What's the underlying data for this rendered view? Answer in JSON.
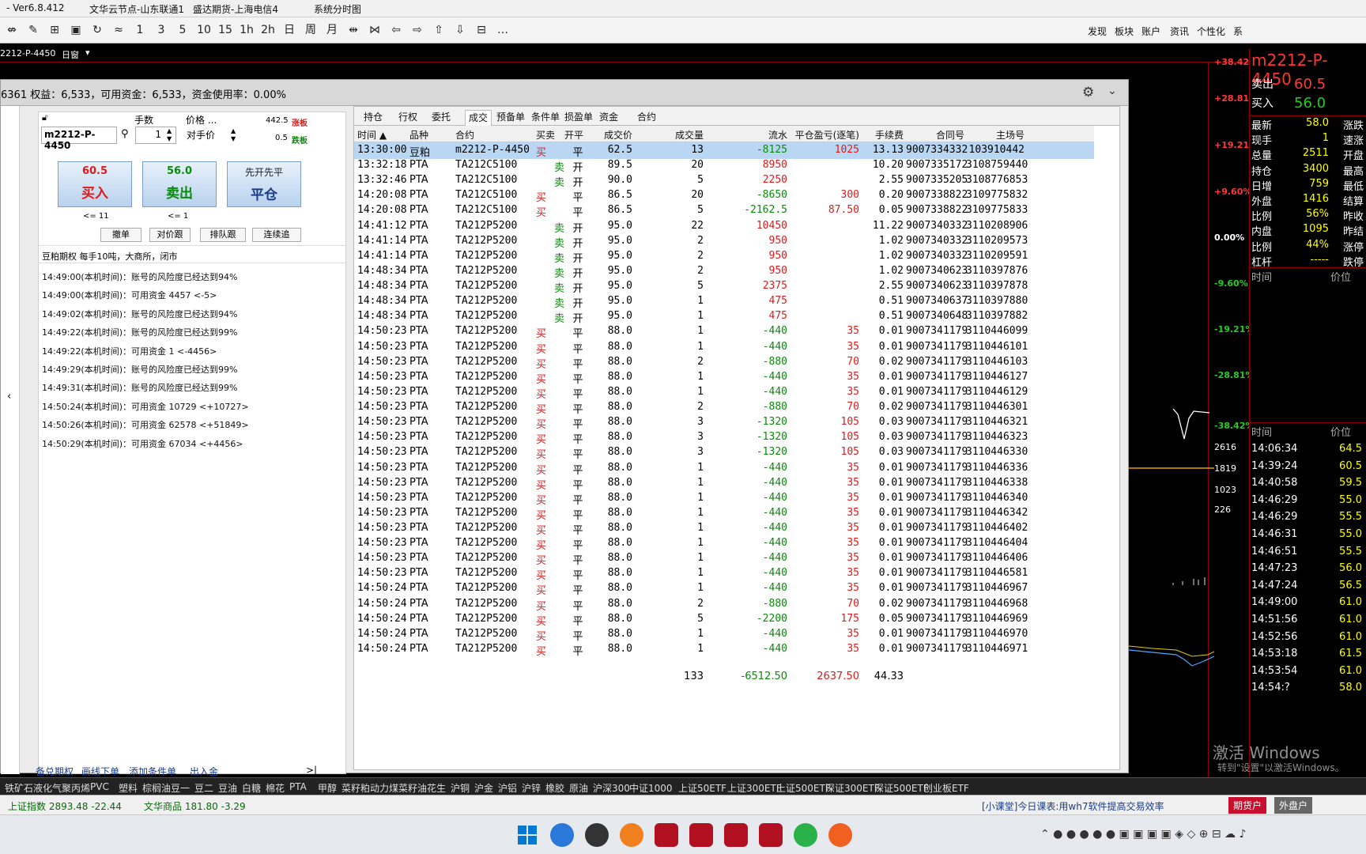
{
  "titlebar": {
    "version": "- Ver6.8.412",
    "node": "文华云节点-山东联通1",
    "broker": "盛达期货-上海电信4",
    "view": "系统分时图"
  },
  "toolbar": {
    "glyphs": [
      "⇎",
      "✎",
      "⊞",
      "▣",
      "↻",
      "≈",
      "1",
      "3",
      "5",
      "10",
      "15",
      "1h",
      "2h",
      "日",
      "周",
      "月",
      "⇹",
      "⋈",
      "⇦",
      "⇨",
      "⇧",
      "⇩",
      "⊟",
      "…"
    ],
    "menus": [
      "发现",
      "板块",
      "账户",
      "资讯",
      "个性化",
      "系"
    ]
  },
  "chartbar": {
    "symbol": "2212-P-4450",
    "period": "日窗"
  },
  "chart": {
    "pct_labels": [
      "+38.42%",
      "+28.81%",
      "+19.21%",
      "+9.60%",
      "0.00%",
      "-9.60%",
      "-19.21%",
      "-28.81%",
      "-38.42%"
    ],
    "vol_labels": [
      "2616",
      "1819",
      "1023",
      "226"
    ]
  },
  "quote": {
    "symbol": "m2212-P-4450",
    "ask_label": "卖出",
    "ask": "60.5",
    "bid_label": "买入",
    "bid": "56.0",
    "rows": [
      {
        "a": "最新",
        "b": "58.0",
        "c": "涨跌"
      },
      {
        "a": "现手",
        "b": "1",
        "c": "速涨"
      },
      {
        "a": "总量",
        "b": "2511",
        "c": "开盘"
      },
      {
        "a": "持仓",
        "b": "3400",
        "c": "最高"
      },
      {
        "a": "日增",
        "b": "759",
        "c": "最低"
      },
      {
        "a": "外盘",
        "b": "1416",
        "c": "结算"
      },
      {
        "a": "比例",
        "b": "56%",
        "c": "昨收"
      },
      {
        "a": "内盘",
        "b": "1095",
        "c": "昨结"
      },
      {
        "a": "比例",
        "b": "44%",
        "c": "涨停"
      },
      {
        "a": "杠杆",
        "b": "-----",
        "c": "跌停"
      }
    ],
    "head1": {
      "t": "时间",
      "p": "价位"
    },
    "head2": {
      "t": "时间",
      "p": "价位"
    },
    "ticks": [
      {
        "t": "14:06:34",
        "p": "64.5"
      },
      {
        "t": "14:39:24",
        "p": "60.5"
      },
      {
        "t": "14:40:58",
        "p": "59.5"
      },
      {
        "t": "14:46:29",
        "p": "55.0"
      },
      {
        "t": "14:46:29",
        "p": "55.5"
      },
      {
        "t": "14:46:31",
        "p": "55.0"
      },
      {
        "t": "14:46:51",
        "p": "55.5"
      },
      {
        "t": "14:47:23",
        "p": "56.0"
      },
      {
        "t": "14:47:24",
        "p": "56.5"
      },
      {
        "t": "14:49:00",
        "p": "61.0"
      },
      {
        "t": "14:51:56",
        "p": "61.0"
      },
      {
        "t": "14:52:56",
        "p": "61.0"
      },
      {
        "t": "14:53:18",
        "p": "61.5"
      },
      {
        "t": "14:53:54",
        "p": "61.0"
      },
      {
        "t": "14:54:?",
        "p": "58.0"
      }
    ]
  },
  "window": {
    "title": "6361 权益：6,533，可用资金：6,533，资金使用率：0.00%"
  },
  "order": {
    "contract": "m2212-P-4450",
    "qty_label": "手数",
    "qty": "1",
    "price_label": "价格 ...",
    "price_mode": "对手价",
    "limit_up": "442.5",
    "limit_up_label": "涨板",
    "limit_down": "0.5",
    "limit_down_label": "跌板",
    "buy": {
      "price": "60.5",
      "label": "买入",
      "limit": "<= 11"
    },
    "sell": {
      "price": "56.0",
      "label": "卖出",
      "limit": "<= 1"
    },
    "close": {
      "price": "先开先平",
      "label": "平仓"
    },
    "small_buttons": [
      "撤单",
      "对价跟",
      "排队跟",
      "连续追"
    ],
    "info": "豆粕期权  每手10吨，大商所，闭市"
  },
  "logs": [
    "14:49:00(本机时间)：账号的风险度已经达到94%",
    "14:49:00(本机时间)：可用资金 4457 <-5>",
    "14:49:02(本机时间)：账号的风险度已经达到94%",
    "14:49:22(本机时间)：账号的风险度已经达到99%",
    "14:49:22(本机时间)：可用资金 1 <-4456>",
    "14:49:29(本机时间)：账号的风险度已经达到99%",
    "14:49:31(本机时间)：账号的风险度已经达到99%",
    "14:50:24(本机时间)：可用资金 10729 <+10727>",
    "14:50:26(本机时间)：可用资金 62578 <+51849>",
    "14:50:29(本机时间)：可用资金 67034 <+4456>"
  ],
  "bottom_links": [
    "备兑期权",
    "画线下单",
    "添加条件单",
    "出入金"
  ],
  "tabs": [
    "持仓",
    "行权",
    "委托",
    "成交",
    "预备单",
    "条件单",
    "损盈单",
    "资金",
    "合约"
  ],
  "columns": [
    "时间 ▲",
    "品种",
    "合约",
    "买卖",
    "开平",
    "成交价",
    "成交量",
    "流水",
    "平仓盈亏(逐笔)",
    "手续费",
    "合同号",
    "主场号"
  ],
  "trades": [
    [
      "13:30:00",
      "豆粕",
      "m2212-P-4450",
      "买",
      "平",
      "62.5",
      "13",
      "-8125",
      "1025",
      "13.13",
      "9007334332",
      "103910442"
    ],
    [
      "13:32:18",
      "PTA",
      "TA212C5100",
      "卖",
      "开",
      "89.5",
      "20",
      "8950",
      "",
      "10.20",
      "9007335172",
      "3108759440"
    ],
    [
      "13:32:46",
      "PTA",
      "TA212C5100",
      "卖",
      "开",
      "90.0",
      "5",
      "2250",
      "",
      "2.55",
      "9007335205",
      "3108776853"
    ],
    [
      "14:20:08",
      "PTA",
      "TA212C5100",
      "买",
      "平",
      "86.5",
      "20",
      "-8650",
      "300",
      "0.20",
      "9007338822",
      "3109775832"
    ],
    [
      "14:20:08",
      "PTA",
      "TA212C5100",
      "买",
      "平",
      "86.5",
      "5",
      "-2162.5",
      "87.50",
      "0.05",
      "9007338822",
      "3109775833"
    ],
    [
      "14:41:12",
      "PTA",
      "TA212P5200",
      "卖",
      "开",
      "95.0",
      "22",
      "10450",
      "",
      "11.22",
      "9007340332",
      "3110208906"
    ],
    [
      "14:41:14",
      "PTA",
      "TA212P5200",
      "卖",
      "开",
      "95.0",
      "2",
      "950",
      "",
      "1.02",
      "9007340332",
      "3110209573"
    ],
    [
      "14:41:14",
      "PTA",
      "TA212P5200",
      "卖",
      "开",
      "95.0",
      "2",
      "950",
      "",
      "1.02",
      "9007340332",
      "3110209591"
    ],
    [
      "14:48:34",
      "PTA",
      "TA212P5200",
      "卖",
      "开",
      "95.0",
      "2",
      "950",
      "",
      "1.02",
      "9007340623",
      "3110397876"
    ],
    [
      "14:48:34",
      "PTA",
      "TA212P5200",
      "卖",
      "开",
      "95.0",
      "5",
      "2375",
      "",
      "2.55",
      "9007340623",
      "3110397878"
    ],
    [
      "14:48:34",
      "PTA",
      "TA212P5200",
      "卖",
      "开",
      "95.0",
      "1",
      "475",
      "",
      "0.51",
      "9007340637",
      "3110397880"
    ],
    [
      "14:48:34",
      "PTA",
      "TA212P5200",
      "卖",
      "开",
      "95.0",
      "1",
      "475",
      "",
      "0.51",
      "9007340648",
      "3110397882"
    ],
    [
      "14:50:23",
      "PTA",
      "TA212P5200",
      "买",
      "平",
      "88.0",
      "1",
      "-440",
      "35",
      "0.01",
      "9007341179",
      "3110446099"
    ],
    [
      "14:50:23",
      "PTA",
      "TA212P5200",
      "买",
      "平",
      "88.0",
      "1",
      "-440",
      "35",
      "0.01",
      "9007341179",
      "3110446101"
    ],
    [
      "14:50:23",
      "PTA",
      "TA212P5200",
      "买",
      "平",
      "88.0",
      "2",
      "-880",
      "70",
      "0.02",
      "9007341179",
      "3110446103"
    ],
    [
      "14:50:23",
      "PTA",
      "TA212P5200",
      "买",
      "平",
      "88.0",
      "1",
      "-440",
      "35",
      "0.01",
      "9007341179",
      "3110446127"
    ],
    [
      "14:50:23",
      "PTA",
      "TA212P5200",
      "买",
      "平",
      "88.0",
      "1",
      "-440",
      "35",
      "0.01",
      "9007341179",
      "3110446129"
    ],
    [
      "14:50:23",
      "PTA",
      "TA212P5200",
      "买",
      "平",
      "88.0",
      "2",
      "-880",
      "70",
      "0.02",
      "9007341179",
      "3110446301"
    ],
    [
      "14:50:23",
      "PTA",
      "TA212P5200",
      "买",
      "平",
      "88.0",
      "3",
      "-1320",
      "105",
      "0.03",
      "9007341179",
      "3110446321"
    ],
    [
      "14:50:23",
      "PTA",
      "TA212P5200",
      "买",
      "平",
      "88.0",
      "3",
      "-1320",
      "105",
      "0.03",
      "9007341179",
      "3110446323"
    ],
    [
      "14:50:23",
      "PTA",
      "TA212P5200",
      "买",
      "平",
      "88.0",
      "3",
      "-1320",
      "105",
      "0.03",
      "9007341179",
      "3110446330"
    ],
    [
      "14:50:23",
      "PTA",
      "TA212P5200",
      "买",
      "平",
      "88.0",
      "1",
      "-440",
      "35",
      "0.01",
      "9007341179",
      "3110446336"
    ],
    [
      "14:50:23",
      "PTA",
      "TA212P5200",
      "买",
      "平",
      "88.0",
      "1",
      "-440",
      "35",
      "0.01",
      "9007341179",
      "3110446338"
    ],
    [
      "14:50:23",
      "PTA",
      "TA212P5200",
      "买",
      "平",
      "88.0",
      "1",
      "-440",
      "35",
      "0.01",
      "9007341179",
      "3110446340"
    ],
    [
      "14:50:23",
      "PTA",
      "TA212P5200",
      "买",
      "平",
      "88.0",
      "1",
      "-440",
      "35",
      "0.01",
      "9007341179",
      "3110446342"
    ],
    [
      "14:50:23",
      "PTA",
      "TA212P5200",
      "买",
      "平",
      "88.0",
      "1",
      "-440",
      "35",
      "0.01",
      "9007341179",
      "3110446402"
    ],
    [
      "14:50:23",
      "PTA",
      "TA212P5200",
      "买",
      "平",
      "88.0",
      "1",
      "-440",
      "35",
      "0.01",
      "9007341179",
      "3110446404"
    ],
    [
      "14:50:23",
      "PTA",
      "TA212P5200",
      "买",
      "平",
      "88.0",
      "1",
      "-440",
      "35",
      "0.01",
      "9007341179",
      "3110446406"
    ],
    [
      "14:50:23",
      "PTA",
      "TA212P5200",
      "买",
      "平",
      "88.0",
      "1",
      "-440",
      "35",
      "0.01",
      "9007341179",
      "3110446581"
    ],
    [
      "14:50:24",
      "PTA",
      "TA212P5200",
      "买",
      "平",
      "88.0",
      "1",
      "-440",
      "35",
      "0.01",
      "9007341179",
      "3110446967"
    ],
    [
      "14:50:24",
      "PTA",
      "TA212P5200",
      "买",
      "平",
      "88.0",
      "2",
      "-880",
      "70",
      "0.02",
      "9007341179",
      "3110446968"
    ],
    [
      "14:50:24",
      "PTA",
      "TA212P5200",
      "买",
      "平",
      "88.0",
      "5",
      "-2200",
      "175",
      "0.05",
      "9007341179",
      "3110446969"
    ],
    [
      "14:50:24",
      "PTA",
      "TA212P5200",
      "买",
      "平",
      "88.0",
      "1",
      "-440",
      "35",
      "0.01",
      "9007341179",
      "3110446970"
    ],
    [
      "14:50:24",
      "PTA",
      "TA212P5200",
      "买",
      "平",
      "88.0",
      "1",
      "-440",
      "35",
      "0.01",
      "9007341179",
      "3110446971"
    ]
  ],
  "totals": {
    "volume": "133",
    "flow": "-6512.50",
    "pnl": "2637.50",
    "fee": "44.33"
  },
  "bottom_strip": [
    "铁矿石",
    "液化气",
    "聚丙烯",
    "PVC",
    "塑料",
    "棕榈油",
    "豆一",
    "豆二",
    "豆油",
    "白糖",
    "棉花",
    "PTA",
    "甲醇",
    "菜籽粕",
    "动力煤",
    "菜籽油",
    "花生",
    "沪铜",
    "沪金",
    "沪铝",
    "沪锌",
    "橡胶",
    "原油",
    "沪深300",
    "中证1000",
    "上证50ETF",
    "上证300ETF",
    "上证500ETF",
    "深证300ETF",
    "深证500ETF",
    "创业板ETF"
  ],
  "status": {
    "index1": "上证指数 2893.48 -22.44",
    "index2": "文华商品 181.80 -3.29",
    "notice": "[小课堂]今日课表:用wh7软件提高交易效率",
    "btn1": "期货户",
    "btn2": "外盘户"
  },
  "watermark": {
    "l1": "激活 Windows",
    "l2": "转到\"设置\"以激活Windows。"
  },
  "colors": {
    "buy": "#e0191a",
    "sell": "#0a8a0a",
    "selection": "#b9d6f2",
    "chart_bg": "#000000",
    "axis_red": "#8b0000"
  }
}
